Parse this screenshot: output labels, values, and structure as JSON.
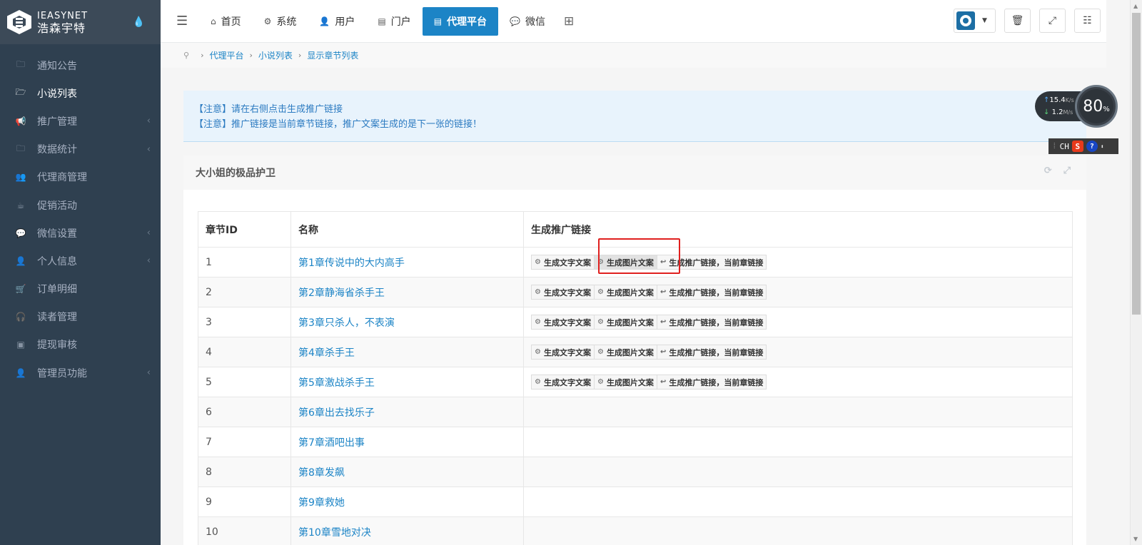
{
  "logo": {
    "en": "IEASYNET",
    "cn": "浩森宇特"
  },
  "sidebar": {
    "items": [
      {
        "label": "通知公告",
        "icon": "folder-icon",
        "arrow": false,
        "active": false
      },
      {
        "label": "小说列表",
        "icon": "folder-open-icon",
        "arrow": false,
        "active": true
      },
      {
        "label": "推广管理",
        "icon": "bullhorn-icon",
        "arrow": true,
        "active": false
      },
      {
        "label": "数据统计",
        "icon": "folder-icon",
        "arrow": true,
        "active": false
      },
      {
        "label": "代理商管理",
        "icon": "users-icon",
        "arrow": false,
        "active": false
      },
      {
        "label": "促销活动",
        "icon": "coffee-icon",
        "arrow": false,
        "active": false
      },
      {
        "label": "微信设置",
        "icon": "wechat-icon",
        "arrow": true,
        "active": false
      },
      {
        "label": "个人信息",
        "icon": "user-icon",
        "arrow": true,
        "active": false
      },
      {
        "label": "订单明细",
        "icon": "cart-icon",
        "arrow": false,
        "active": false
      },
      {
        "label": "读者管理",
        "icon": "headphones-icon",
        "arrow": false,
        "active": false
      },
      {
        "label": "提现审核",
        "icon": "money-icon",
        "arrow": false,
        "active": false
      },
      {
        "label": "管理员功能",
        "icon": "user-lock-icon",
        "arrow": true,
        "active": false
      }
    ]
  },
  "topbar": {
    "tabs": [
      {
        "label": "首页",
        "icon": "home-icon",
        "active": false
      },
      {
        "label": "系统",
        "icon": "gear-icon",
        "active": false
      },
      {
        "label": "用户",
        "icon": "user-icon",
        "active": false
      },
      {
        "label": "门户",
        "icon": "newspaper-icon",
        "active": false
      },
      {
        "label": "代理平台",
        "icon": "newspaper-icon",
        "active": true
      },
      {
        "label": "微信",
        "icon": "wechat-icon",
        "active": false
      }
    ]
  },
  "breadcrumb": [
    "代理平台",
    "小说列表",
    "显示章节列表"
  ],
  "alert": {
    "line1": "【注意】请在右侧点击生成推广链接",
    "line2": "【注意】推广链接是当前章节链接，推广文案生成的是下一张的链接！"
  },
  "panel": {
    "title": "大小姐的极品护卫"
  },
  "table": {
    "headers": [
      "章节ID",
      "名称",
      "生成推广链接"
    ],
    "buttons": {
      "text": "生成文字文案",
      "image": "生成图片文案",
      "link": "生成推广链接，当前章链接"
    },
    "rows": [
      {
        "id": "1",
        "name": "第1章传说中的大内高手",
        "actions": true
      },
      {
        "id": "2",
        "name": "第2章静海省杀手王",
        "actions": true
      },
      {
        "id": "3",
        "name": "第3章只杀人，不表演",
        "actions": true
      },
      {
        "id": "4",
        "name": "第4章杀手王",
        "actions": true
      },
      {
        "id": "5",
        "name": "第5章激战杀手王",
        "actions": true
      },
      {
        "id": "6",
        "name": "第6章出去找乐子",
        "actions": false
      },
      {
        "id": "7",
        "name": "第7章酒吧出事",
        "actions": false
      },
      {
        "id": "8",
        "name": "第8章发飙",
        "actions": false
      },
      {
        "id": "9",
        "name": "第9章救她",
        "actions": false
      },
      {
        "id": "10",
        "name": "第10章雪地对决",
        "actions": false
      }
    ]
  },
  "netmon": {
    "up": "15.4",
    "up_unit": "K/s",
    "down": "1.2",
    "down_unit": "M/s",
    "percent": "80",
    "percent_unit": "%"
  },
  "ime": {
    "lang": "CH",
    "s": "S",
    "help": "?"
  },
  "colors": {
    "sidebar": "#2f4050",
    "accent": "#1c84c6",
    "highlight": "#e0201f"
  }
}
